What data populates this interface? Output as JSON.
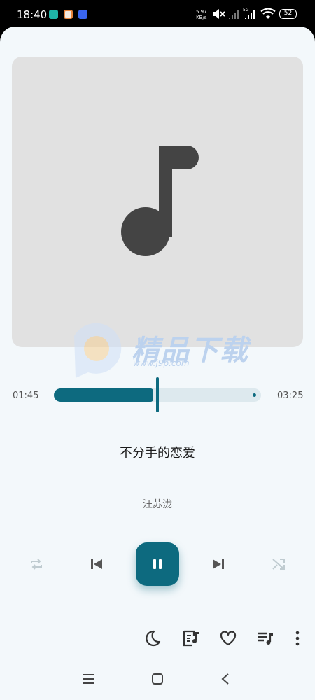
{
  "status_bar": {
    "time": "18:40",
    "net_speed_value": "5.97",
    "net_speed_unit": "KB/s",
    "network_label": "5G",
    "battery": "52"
  },
  "player": {
    "current_time": "01:45",
    "total_time": "03:25",
    "progress": 0.5,
    "song_title": "不分手的恋爱",
    "artist": "汪苏泷"
  },
  "watermark": {
    "brand": "精品下载",
    "url": "www.j9p.com"
  },
  "colors": {
    "accent": "#0d6a7f",
    "track_bg": "#dde9ee",
    "artwork_bg": "#e1e1e1",
    "surface": "#f3f8fb"
  },
  "icons": {
    "controls": [
      "repeat-icon",
      "skip-previous-icon",
      "pause-icon",
      "skip-next-icon",
      "shuffle-icon"
    ],
    "bottom_bar": [
      "sleep-timer-icon",
      "lyrics-icon",
      "favorite-icon",
      "queue-icon",
      "more-icon"
    ],
    "nav": [
      "menu-icon",
      "home-icon",
      "back-icon"
    ]
  }
}
